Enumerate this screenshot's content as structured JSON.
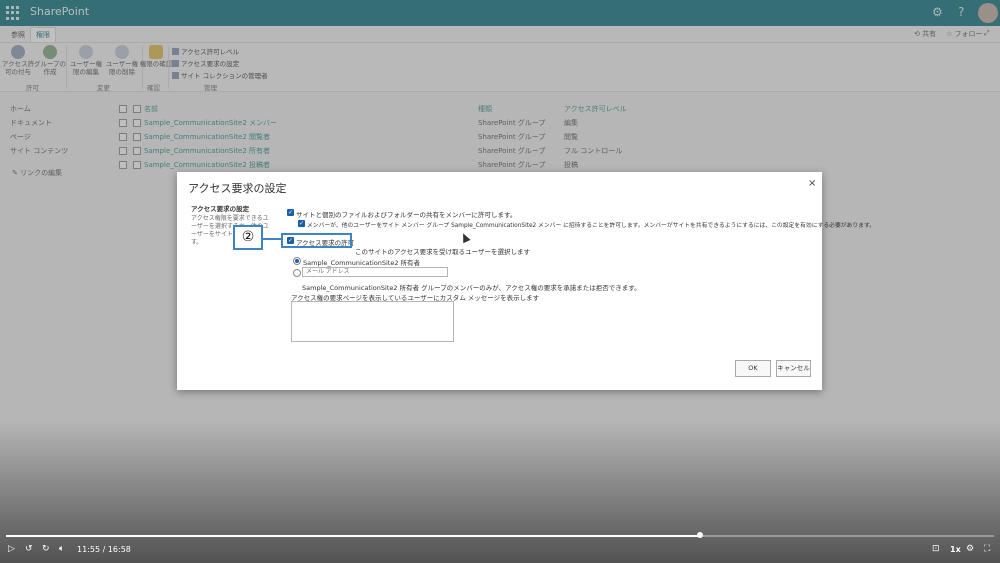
{
  "suite": {
    "brand": "SharePoint",
    "settings_icon": "gear-icon",
    "help_icon": "?"
  },
  "ribbon": {
    "tabs": [
      "参照",
      "権限"
    ],
    "share_label": "共有",
    "follow_label": "フォロー",
    "buttons": {
      "grant": "アクセス許可の付与",
      "create_group": "グループの作成",
      "edit_user": "ユーザー権限の編集",
      "remove_user": "ユーザー権限の削除",
      "check": "権限の確認"
    },
    "small": [
      "アクセス許可レベル",
      "アクセス要求の設定",
      "サイト コレクションの管理者"
    ],
    "groups": [
      "許可",
      "変更",
      "確認",
      "管理"
    ]
  },
  "nav": [
    "ホーム",
    "ドキュメント",
    "ページ",
    "サイト コンテンツ"
  ],
  "edit_links": "リンクの編集",
  "table": {
    "headers": {
      "name": "名前",
      "type": "種類",
      "level": "アクセス許可レベル"
    },
    "rows": [
      {
        "name": "Sample_CommunicationSite2 メンバー",
        "type": "SharePoint グループ",
        "level": "編集"
      },
      {
        "name": "Sample_CommunicationSite2 閲覧者",
        "type": "SharePoint グループ",
        "level": "閲覧"
      },
      {
        "name": "Sample_CommunicationSite2 所有者",
        "type": "SharePoint グループ",
        "level": "フル コントロール"
      },
      {
        "name": "Sample_CommunicationSite2 投稿者",
        "type": "SharePoint グループ",
        "level": "投稿"
      }
    ]
  },
  "dialog": {
    "title": "アクセス要求の設定",
    "close": "×",
    "section_title": "アクセス要求の設定",
    "section_desc": "アクセス権限を要求できるユーザーを選択するか、他のユーザーをサイトに招待します。",
    "opt1": "サイトと個別のファイルおよびフォルダーの共有をメンバーに許可します。",
    "opt1_sub": "メンバーが、他のユーザーをサイト メンバー グループ Sample_CommunicationSite2 メンバー に招待することを許可します。メンバーがサイトを共有できるようにするには、この設定を有効にする必要があります。",
    "opt2": "アクセス要求の許可",
    "opt2_desc": "このサイトのアクセス要求を受け取るユーザーを選択します",
    "radio1": "Sample_CommunicationSite2 所有者",
    "email_placeholder": "メール アドレス",
    "owner_note": "Sample_CommunicationSite2 所有者 グループのメンバーのみが、アクセス権の要求を承諾または拒否できます。",
    "custom_msg_label": "アクセス権の要求ページを表示しているユーザーにカスタム メッセージを表示します",
    "ok": "OK",
    "cancel": "キャンセル"
  },
  "annotation": {
    "marker": "②"
  },
  "player": {
    "time": "11:55 / 16:58",
    "progress": 0.702,
    "speed": "1x",
    "icons": [
      "play-icon",
      "rewind-icon",
      "forward-icon",
      "volume-icon",
      "captions-icon",
      "settings-icon",
      "fullscreen-icon"
    ]
  },
  "colors": {
    "suite": "#0f6e7a",
    "link": "#2a8a7f",
    "checkbox": "#1b5fa8",
    "annotation": "#3d83c7"
  }
}
